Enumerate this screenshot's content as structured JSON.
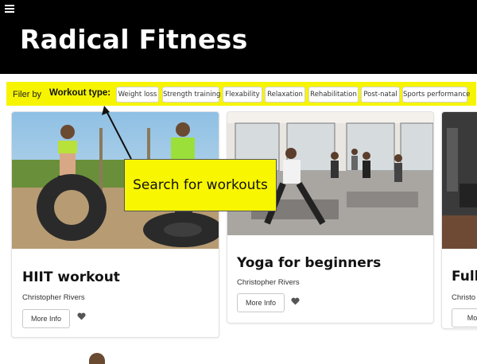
{
  "header": {
    "menu_icon": "hamburger-menu-icon",
    "title": "Radical Fitness",
    "background": "#000000"
  },
  "filter": {
    "label": "Filer by",
    "type_label": "Workout type:",
    "background": "#f6f400",
    "options": [
      "Weight loss",
      "Strength training",
      "Flexability",
      "Relaxation",
      "Rehabilitation",
      "Post-natal",
      "Sports performance"
    ]
  },
  "cards": [
    {
      "title": "HIIT workout",
      "author": "Christopher Rivers",
      "button": "More Info",
      "icon": "heart-icon",
      "image": "tire-training-photo"
    },
    {
      "title": "Yoga for beginners",
      "author": "Christopher Rivers",
      "button": "More Info",
      "icon": "heart-icon",
      "image": "yoga-class-photo"
    },
    {
      "title": "Full",
      "author": "Christo",
      "button": "More",
      "icon": "heart-icon",
      "image": "gym-photo"
    }
  ],
  "callout": {
    "text": "Search for workouts",
    "background": "#f8f600"
  }
}
